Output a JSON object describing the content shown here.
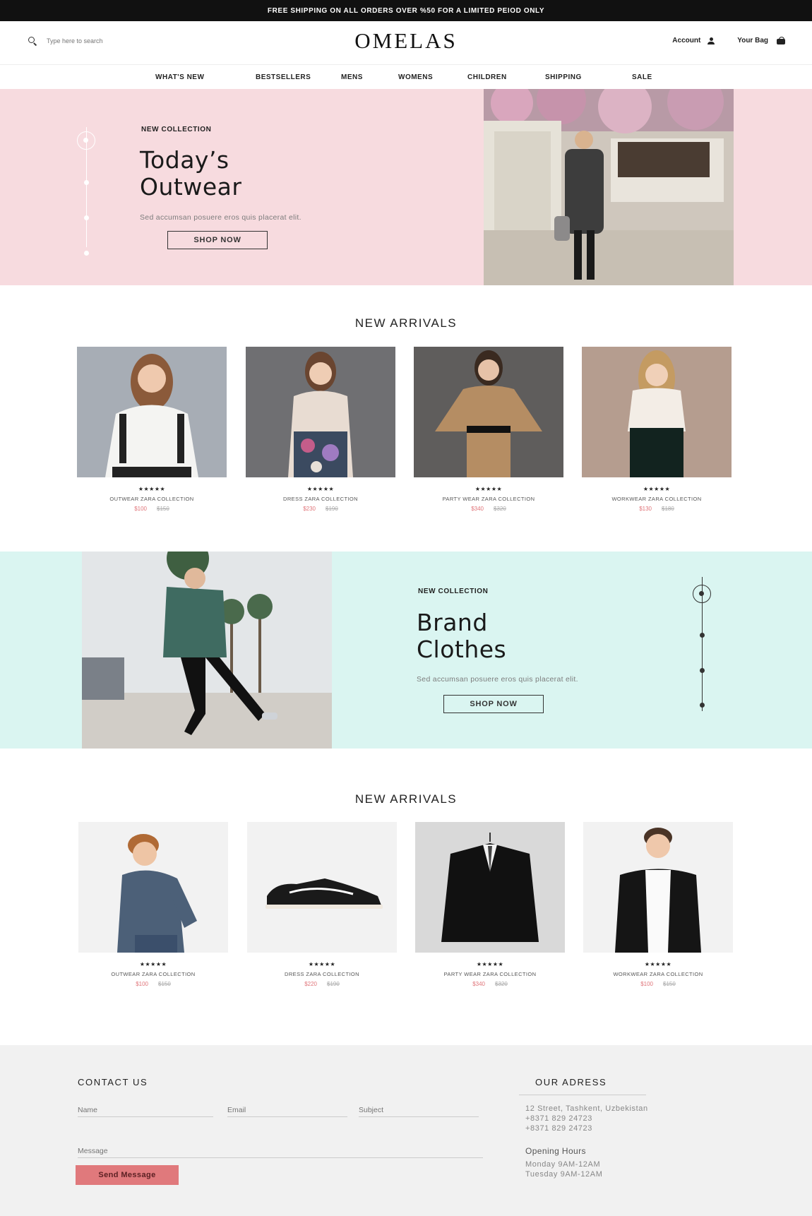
{
  "announcement": "FREE SHIPPING ON ALL ORDERS OVER %50 FOR A LIMITED PEIOD ONLY",
  "header": {
    "search_placeholder": "Type here to search",
    "logo": "OMELAS",
    "account_label": "Account",
    "bag_label": "Your Bag"
  },
  "nav": [
    "WHAT'S NEW",
    "BESTSELLERS",
    "MENS",
    "WOMENS",
    "CHILDREN",
    "SHIPPING",
    "SALE"
  ],
  "hero1": {
    "eyebrow": "NEW COLLECTION",
    "title_line1": "Today’s",
    "title_line2": "Outwear",
    "text": "Sed accumsan posuere eros quis placerat elit.",
    "button": "SHOP NOW"
  },
  "arrivals1": {
    "title": "NEW ARRIVALS",
    "products": [
      {
        "stars": "★★★★★",
        "name": "OUTWEAR ZARA COLLECTION",
        "price": "$100",
        "old_price": "$150"
      },
      {
        "stars": "★★★★★",
        "name": "DRESS ZARA COLLECTION",
        "price": "$230",
        "old_price": "$190"
      },
      {
        "stars": "★★★★★",
        "name": "PARTY WEAR ZARA COLLECTION",
        "price": "$340",
        "old_price": "$320"
      },
      {
        "stars": "★★★★★",
        "name": "WORKWEAR ZARA COLLECTION",
        "price": "$130",
        "old_price": "$180"
      }
    ]
  },
  "hero2": {
    "eyebrow": "NEW COLLECTION",
    "title_line1": "Brand",
    "title_line2": "Clothes",
    "text": "Sed accumsan posuere eros quis placerat elit.",
    "button": "SHOP NOW"
  },
  "arrivals2": {
    "title": "NEW ARRIVALS",
    "products": [
      {
        "stars": "★★★★★",
        "name": "OUTWEAR ZARA COLLECTION",
        "price": "$100",
        "old_price": "$150"
      },
      {
        "stars": "★★★★★",
        "name": "DRESS ZARA COLLECTION",
        "price": "$220",
        "old_price": "$190"
      },
      {
        "stars": "★★★★★",
        "name": "PARTY WEAR ZARA COLLECTION",
        "price": "$340",
        "old_price": "$320"
      },
      {
        "stars": "★★★★★",
        "name": "WORKWEAR ZARA COLLECTION",
        "price": "$100",
        "old_price": "$150"
      }
    ]
  },
  "contact": {
    "title": "CONTACT US",
    "name_placeholder": "Name",
    "email_placeholder": "Email",
    "subject_placeholder": "Subject",
    "message_placeholder": "Message",
    "send_button": "Send Message"
  },
  "address": {
    "title": "OUR ADRESS",
    "lines": [
      "12 Street, Tashkent, Uzbekistan",
      "+8371 829 24723",
      "+8371 829 24723"
    ],
    "hours_title": "Opening Hours",
    "hours": [
      "Monday 9AM-12AM",
      "Tuesday 9AM-12AM"
    ]
  },
  "colors": {
    "hero1_bg": "#f7dbdf",
    "hero2_bg": "#daf5f1",
    "accent": "#e0797c",
    "topbar": "#111111",
    "footer_bg": "#f1f1f1"
  }
}
